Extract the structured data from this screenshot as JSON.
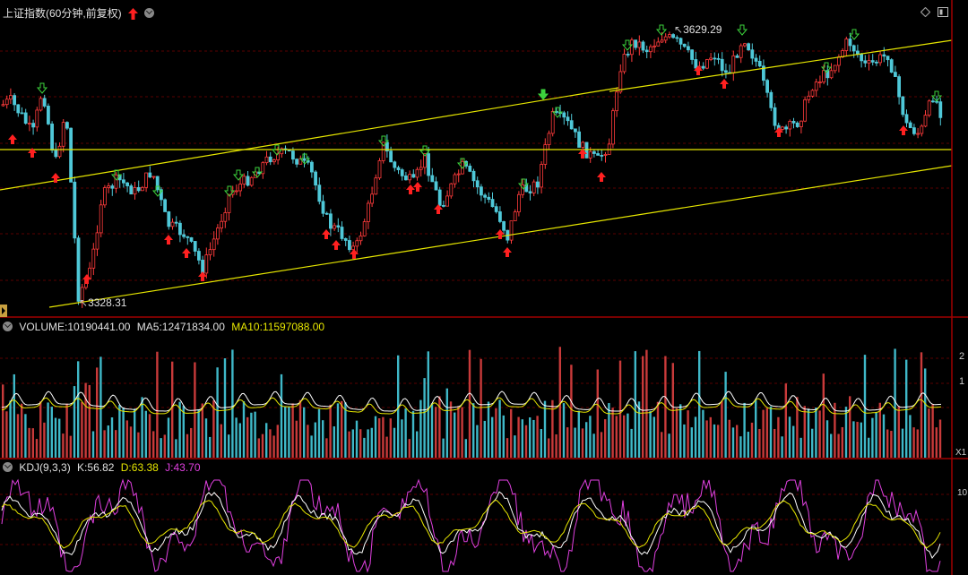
{
  "header": {
    "title": "上证指数(60分钟,前复权)",
    "vol_label": "VOLUME:",
    "vol_value": "10190441.00",
    "ma5_label": "MA5:",
    "ma5_value": "12471834.00",
    "ma10_label": "MA10:",
    "ma10_value": "11597088.00",
    "kdj_label": "KDJ(9,3,3)",
    "k_label": "K:",
    "k_value": "56.82",
    "d_label": "D:",
    "d_value": "63.38",
    "j_label": "J:",
    "j_value": "43.70"
  },
  "annotations": {
    "low": "3328.31",
    "high": "3629.29"
  },
  "right_axis": {
    "volume_ticks": [
      "2",
      "1"
    ],
    "volume_unit": "X1",
    "kdj_ticks": [
      "10"
    ]
  },
  "colors": {
    "up": "#ff3b3b",
    "down": "#4fc8d8",
    "ma5": "#ffffff",
    "ma10": "#e6e600",
    "k": "#ffffff",
    "d": "#e6e600",
    "j": "#e040e0",
    "trend": "#e6e600",
    "signal_buy": "#ff2020",
    "signal_sell": "#3cd23c"
  },
  "chart_data": [
    {
      "type": "candlestick",
      "title": "上证指数(60分钟,前复权)",
      "series": [
        {
          "name": "上证指数",
          "low_marked": 3328.31,
          "high_marked": 3629.29
        }
      ],
      "ylim": [
        3300,
        3650
      ],
      "grid": true,
      "trendlines": [
        "upper channel",
        "lower channel",
        "horizontal support",
        "upper ascending"
      ]
    },
    {
      "type": "bar",
      "title": "VOLUME",
      "series": [
        {
          "name": "VOLUME",
          "values": [
            10190441.0
          ]
        },
        {
          "name": "MA5",
          "values": [
            12471834.0
          ]
        },
        {
          "name": "MA10",
          "values": [
            11597088.0
          ]
        }
      ]
    },
    {
      "type": "line",
      "title": "KDJ(9,3,3)",
      "series": [
        {
          "name": "K",
          "values": [
            56.82
          ]
        },
        {
          "name": "D",
          "values": [
            63.38
          ]
        },
        {
          "name": "J",
          "values": [
            43.7
          ]
        }
      ]
    }
  ]
}
